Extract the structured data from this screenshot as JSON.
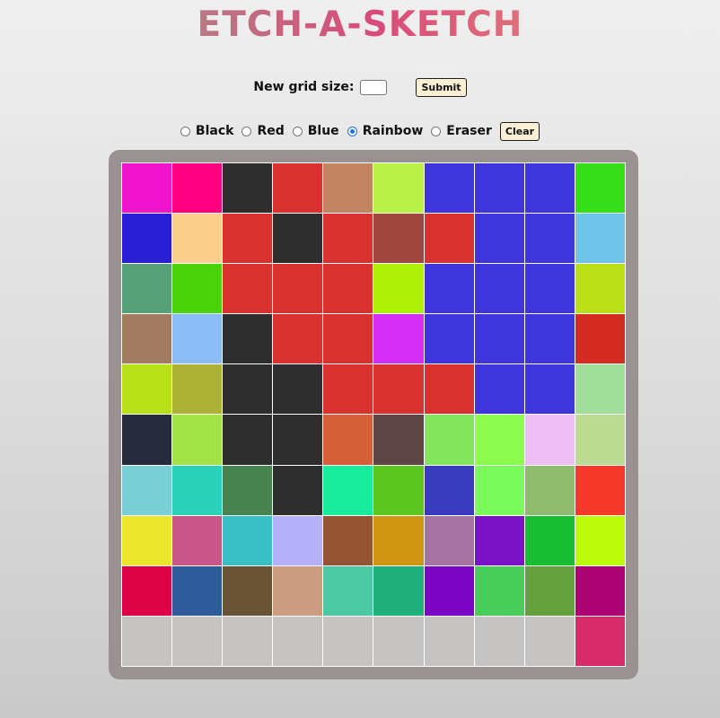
{
  "title": "ETCH-A-SKETCH",
  "size_form": {
    "label": "New grid size:",
    "input_value": "",
    "submit_label": "Submit"
  },
  "modes": [
    {
      "label": "Black",
      "selected": false
    },
    {
      "label": "Red",
      "selected": false
    },
    {
      "label": "Blue",
      "selected": false
    },
    {
      "label": "Rainbow",
      "selected": true
    },
    {
      "label": "Eraser",
      "selected": false
    }
  ],
  "clear_label": "Clear",
  "grid": {
    "size": 10,
    "colors": [
      [
        "#f014cc",
        "#ff0080",
        "#2e2e2e",
        "#d93030",
        "#c38463",
        "#b8f045",
        "#3e35dd",
        "#3e35dd",
        "#3e35dd",
        "#36de1a"
      ],
      [
        "#2a1fd6",
        "#fbd08c",
        "#d93030",
        "#2e2e2e",
        "#d93030",
        "#a0463f",
        "#d93030",
        "#3e35dd",
        "#3e35dd",
        "#70c4e9"
      ],
      [
        "#56a07a",
        "#4ad20a",
        "#d93030",
        "#d93030",
        "#d93030",
        "#b0f008",
        "#3e35dd",
        "#3e35dd",
        "#3e35dd",
        "#bce018"
      ],
      [
        "#a27c60",
        "#8cbcf8",
        "#2e2e2e",
        "#d93030",
        "#d93030",
        "#d42ef6",
        "#3e35dd",
        "#3e35dd",
        "#3e35dd",
        "#d42c22"
      ],
      [
        "#b8e018",
        "#acb236",
        "#2e2e2e",
        "#2e2e2e",
        "#d93030",
        "#d93030",
        "#d93030",
        "#3e35dd",
        "#3e35dd",
        "#a0dc9a"
      ],
      [
        "#262c3c",
        "#a2e246",
        "#2e2e2e",
        "#2e2e2e",
        "#d6603a",
        "#5e4646",
        "#84e45e",
        "#8cfc4e",
        "#ecbef4",
        "#bcdc94"
      ],
      [
        "#78d0d6",
        "#2ad0b8",
        "#488452",
        "#2e2e2e",
        "#16ec9c",
        "#5cc620",
        "#3a3abe",
        "#7afa5c",
        "#90ba6e",
        "#f4382a"
      ],
      [
        "#ece62e",
        "#c85688",
        "#38c0c4",
        "#b6b0f8",
        "#945432",
        "#d09612",
        "#a674a2",
        "#7c12c6",
        "#18be32",
        "#bcfa0a"
      ],
      [
        "#dc0446",
        "#2e5c9a",
        "#6a5234",
        "#cc9c80",
        "#4cc8a2",
        "#20b07c",
        "#7c06c6",
        "#48cc5a",
        "#66a03c",
        "#ac0474"
      ],
      [
        "#c5c4c2",
        "#c5c4c2",
        "#c5c4c2",
        "#c5c4c2",
        "#c5c4c2",
        "#c5c4c2",
        "#c5c4c2",
        "#c5c4c2",
        "#c5c4c2",
        "#d82c6a"
      ]
    ]
  }
}
